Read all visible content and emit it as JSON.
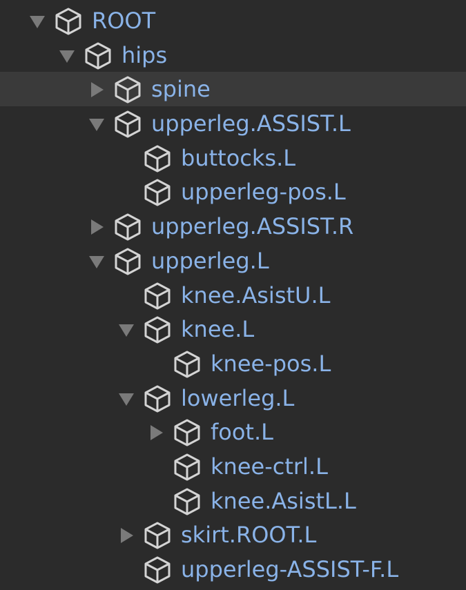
{
  "outliner": {
    "rows": [
      {
        "label": "ROOT",
        "depth": 0,
        "toggle": "expanded",
        "icon": "bone-icon"
      },
      {
        "label": "hips",
        "depth": 1,
        "toggle": "expanded",
        "icon": "bone-icon"
      },
      {
        "label": "spine",
        "depth": 2,
        "toggle": "collapsed",
        "icon": "bone-icon",
        "highlighted": true
      },
      {
        "label": "upperleg.ASSIST.L",
        "depth": 2,
        "toggle": "expanded",
        "icon": "bone-icon"
      },
      {
        "label": "buttocks.L",
        "depth": 3,
        "toggle": "none",
        "icon": "bone-icon"
      },
      {
        "label": "upperleg-pos.L",
        "depth": 3,
        "toggle": "none",
        "icon": "bone-icon"
      },
      {
        "label": "upperleg.ASSIST.R",
        "depth": 2,
        "toggle": "collapsed",
        "icon": "bone-icon"
      },
      {
        "label": "upperleg.L",
        "depth": 2,
        "toggle": "expanded",
        "icon": "bone-icon"
      },
      {
        "label": "knee.AsistU.L",
        "depth": 3,
        "toggle": "none",
        "icon": "bone-icon"
      },
      {
        "label": "knee.L",
        "depth": 3,
        "toggle": "expanded",
        "icon": "bone-icon"
      },
      {
        "label": "knee-pos.L",
        "depth": 4,
        "toggle": "none",
        "icon": "bone-icon"
      },
      {
        "label": "lowerleg.L",
        "depth": 3,
        "toggle": "expanded",
        "icon": "bone-icon"
      },
      {
        "label": "foot.L",
        "depth": 4,
        "toggle": "collapsed",
        "icon": "bone-icon"
      },
      {
        "label": "knee-ctrl.L",
        "depth": 4,
        "toggle": "none",
        "icon": "bone-icon"
      },
      {
        "label": "knee.AsistL.L",
        "depth": 4,
        "toggle": "none",
        "icon": "bone-icon"
      },
      {
        "label": "skirt.ROOT.L",
        "depth": 3,
        "toggle": "collapsed",
        "icon": "bone-icon"
      },
      {
        "label": "upperleg-ASSIST-F.L",
        "depth": 3,
        "toggle": "none",
        "icon": "bone-icon"
      }
    ]
  },
  "colors": {
    "background": "#2b2b2b",
    "highlight_row": "#3a3a3a",
    "label_text": "#8ab3e8",
    "icon_stroke": "#d4d4d4",
    "toggle_fill": "#7a7a7a"
  }
}
